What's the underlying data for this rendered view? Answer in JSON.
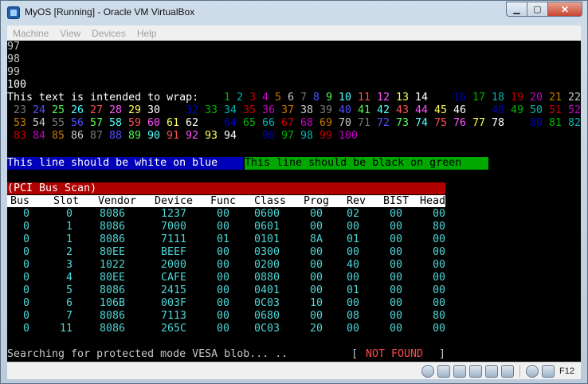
{
  "window": {
    "title": "MyOS [Running] - Oracle VM VirtualBox",
    "minimize_glyph": "▁",
    "maximize_glyph": "▢",
    "close_glyph": "✕"
  },
  "menu": [
    "Machine",
    "View",
    "Devices",
    "Help"
  ],
  "console": {
    "numbers": [
      "97",
      "98",
      "99",
      "100"
    ],
    "wrap_label": "This text is intended to wrap:",
    "palette": [
      "#0000c8",
      "#00b400",
      "#00b4b4",
      "#c80000",
      "#c800c8",
      "#c87800",
      "#c8c8c8",
      "#787878",
      "#5050ff",
      "#50ff50",
      "#50ffff",
      "#ff5050",
      "#ff50ff",
      "#ffff50",
      "#ffffff",
      "#000000"
    ],
    "wrap_numbers": [
      "1",
      "2",
      "3",
      "4",
      "5",
      "6",
      "7",
      "8",
      "9",
      "10",
      "11",
      "12",
      "13",
      "14",
      "15",
      "16",
      "17",
      "18",
      "19",
      "20",
      "21",
      "22",
      "23",
      "24",
      "25",
      "26",
      "27",
      "28",
      "29",
      "30",
      "31",
      "32",
      "33",
      "34",
      "35",
      "36",
      "37",
      "38",
      "39",
      "40",
      "41",
      "42",
      "43",
      "44",
      "45",
      "46",
      "47",
      "48",
      "49",
      "50",
      "51",
      "52",
      "53",
      "54",
      "55",
      "56",
      "57",
      "58",
      "59",
      "60",
      "61",
      "62",
      "63",
      "64",
      "65",
      "66",
      "67",
      "68",
      "69",
      "70",
      "71",
      "72",
      "73",
      "74",
      "75",
      "76",
      "77",
      "78",
      "79",
      "80",
      "81",
      "82",
      "83",
      "84",
      "85",
      "86",
      "87",
      "88",
      "89",
      "90",
      "91",
      "92",
      "93",
      "94",
      "95",
      "96",
      "97",
      "98",
      "99",
      "100"
    ],
    "white_on_blue": "This line should be white on blue",
    "black_on_green": "This line should be black on green"
  },
  "pci": {
    "title": "(PCI Bus Scan)",
    "columns": [
      "Bus",
      "Slot",
      "Vendor",
      "Device",
      "Func",
      "Class",
      "Prog",
      "Rev",
      "BIST",
      "Head"
    ],
    "rows": [
      [
        "0",
        "0",
        "8086",
        "1237",
        "00",
        "0600",
        "00",
        "02",
        "00",
        "00"
      ],
      [
        "0",
        "1",
        "8086",
        "7000",
        "00",
        "0601",
        "00",
        "00",
        "00",
        "80"
      ],
      [
        "0",
        "1",
        "8086",
        "7111",
        "01",
        "0101",
        "8A",
        "01",
        "00",
        "00"
      ],
      [
        "0",
        "2",
        "80EE",
        "BEEF",
        "00",
        "0300",
        "00",
        "00",
        "00",
        "00"
      ],
      [
        "0",
        "3",
        "1022",
        "2000",
        "00",
        "0200",
        "00",
        "40",
        "00",
        "00"
      ],
      [
        "0",
        "4",
        "80EE",
        "CAFE",
        "00",
        "0880",
        "00",
        "00",
        "00",
        "00"
      ],
      [
        "0",
        "5",
        "8086",
        "2415",
        "00",
        "0401",
        "00",
        "01",
        "00",
        "00"
      ],
      [
        "0",
        "6",
        "106B",
        "003F",
        "00",
        "0C03",
        "10",
        "00",
        "00",
        "00"
      ],
      [
        "0",
        "7",
        "8086",
        "7113",
        "00",
        "0680",
        "00",
        "08",
        "00",
        "80"
      ],
      [
        "0",
        "11",
        "8086",
        "265C",
        "00",
        "0C03",
        "20",
        "00",
        "00",
        "00"
      ]
    ]
  },
  "status": {
    "searching": "Searching for protected mode VESA blob... ..",
    "open_bracket": "[",
    "result": "NOT FOUND",
    "close_bracket": "]"
  },
  "statusbar": {
    "icons": [
      "cdrom-icon",
      "usb-icon",
      "network-icon",
      "shared-folder-icon",
      "display-icon",
      "vrde-icon",
      "mouse-integration-icon",
      "host-key-icon"
    ],
    "host_key": "F12"
  }
}
